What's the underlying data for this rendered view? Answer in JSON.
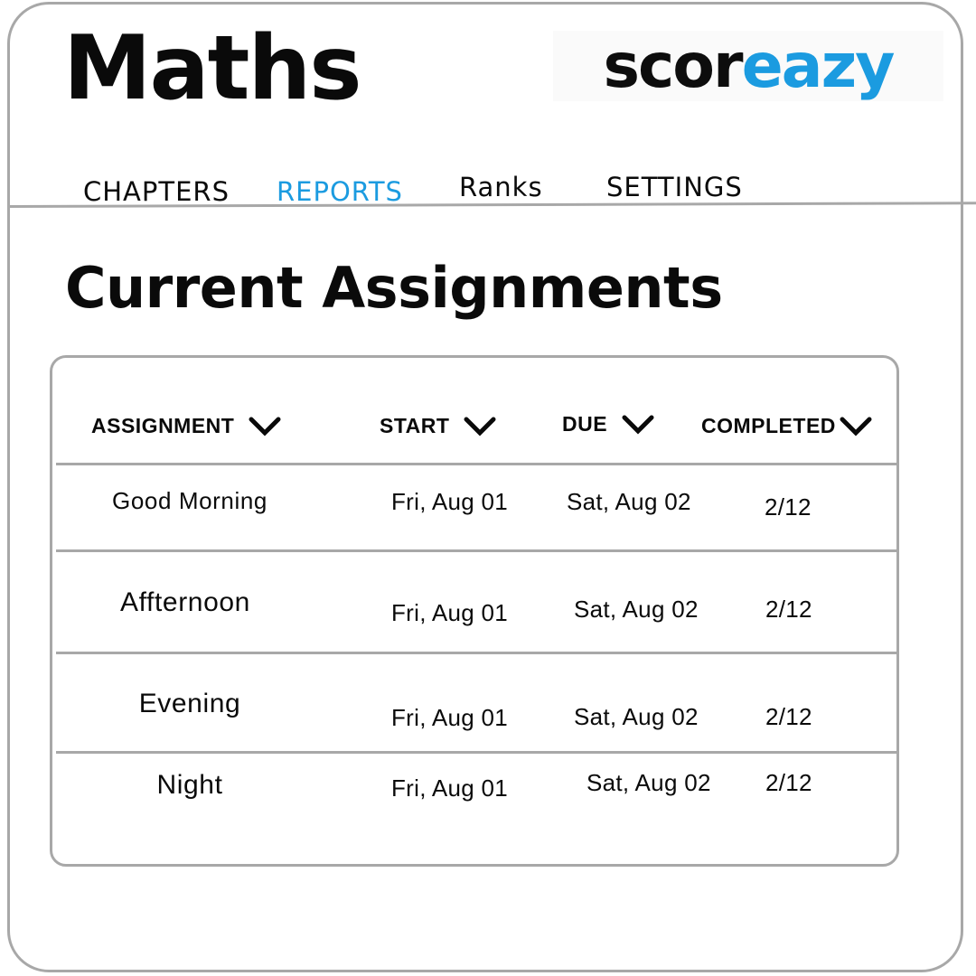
{
  "header": {
    "title": "Maths",
    "logo": {
      "part1": "scor",
      "part2": "eazy"
    }
  },
  "nav": {
    "tabs": [
      {
        "label": "CHAPTERS"
      },
      {
        "label": "REPORTS",
        "active": true
      },
      {
        "label": "Ranks"
      },
      {
        "label": "SETTINGS"
      }
    ]
  },
  "section": {
    "title": "Current Assignments"
  },
  "table": {
    "columns": [
      {
        "label": "ASSIGNMENT"
      },
      {
        "label": "START"
      },
      {
        "label": "DUE"
      },
      {
        "label": "COMPLETED"
      }
    ],
    "rows": [
      {
        "assignment": "Good  Morning",
        "start": "Fri, Aug 01",
        "due": "Sat, Aug 02",
        "completed": "2/12"
      },
      {
        "assignment": "Affternoon",
        "start": "Fri, Aug 01",
        "due": "Sat, Aug 02",
        "completed": "2/12"
      },
      {
        "assignment": "Evening",
        "start": "Fri, Aug 01",
        "due": "Sat, Aug 02",
        "completed": "2/12"
      },
      {
        "assignment": "Night",
        "start": "Fri, Aug 01",
        "due": "Sat, Aug 02",
        "completed": "2/12"
      }
    ]
  },
  "colors": {
    "accent": "#1b9be0",
    "border": "#a8a8a8",
    "text": "#0a0a0a"
  },
  "icons": {
    "sort": "chevron-down-icon"
  }
}
